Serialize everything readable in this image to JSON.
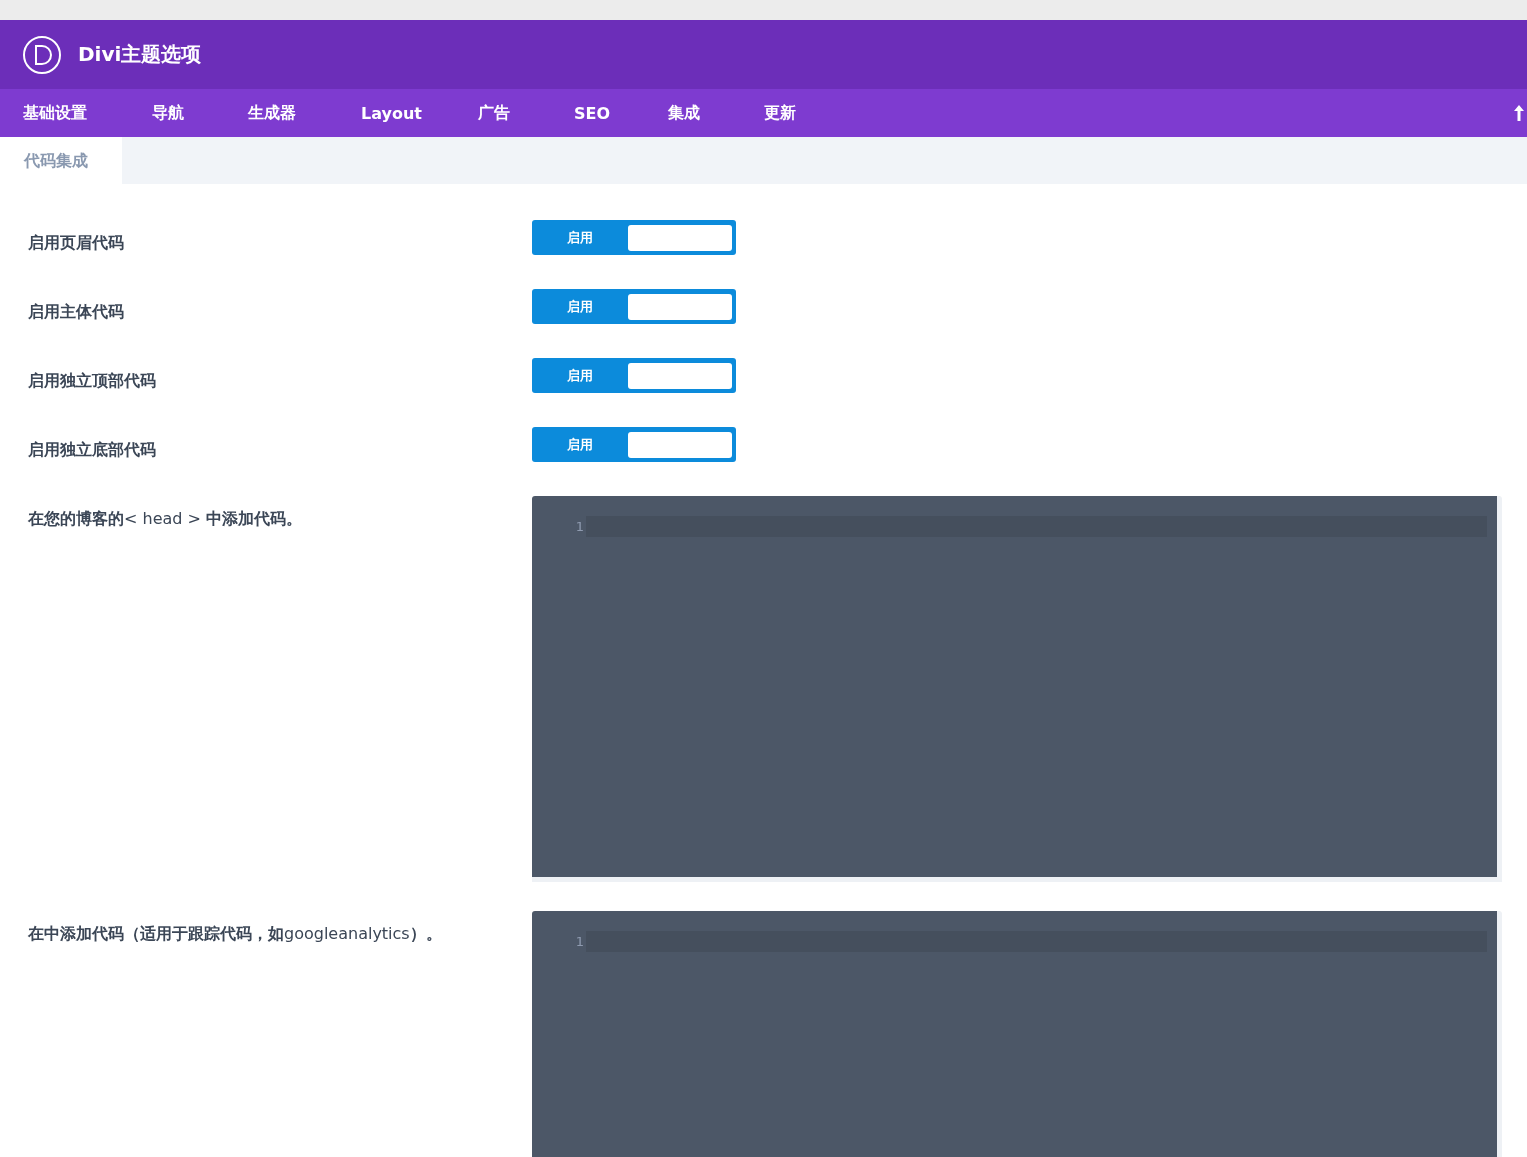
{
  "header": {
    "title": "Divi主题选项"
  },
  "tabs": [
    {
      "label": "基础设置"
    },
    {
      "label": "导航"
    },
    {
      "label": "生成器"
    },
    {
      "label": "Layout"
    },
    {
      "label": "广告"
    },
    {
      "label": "SEO"
    },
    {
      "label": "集成"
    },
    {
      "label": "更新"
    }
  ],
  "subtabs": [
    {
      "label": "代码集成",
      "selected": true
    }
  ],
  "settings": [
    {
      "kind": "toggle",
      "label": "启用页眉代码",
      "on": true,
      "state_text": "启用"
    },
    {
      "kind": "toggle",
      "label": "启用主体代码",
      "on": true,
      "state_text": "启用"
    },
    {
      "kind": "toggle",
      "label": "启用独立顶部代码",
      "on": true,
      "state_text": "启用"
    },
    {
      "kind": "toggle",
      "label": "启用独立底部代码",
      "on": true,
      "state_text": "启用"
    },
    {
      "kind": "code",
      "label": "**在您的博客的**< head > **中添加代码。**",
      "line_number": "1"
    },
    {
      "kind": "code",
      "label": "**在中添加代码（适用于跟踪代码，如**googleanalytics**）。**",
      "line_number": "1"
    }
  ]
}
